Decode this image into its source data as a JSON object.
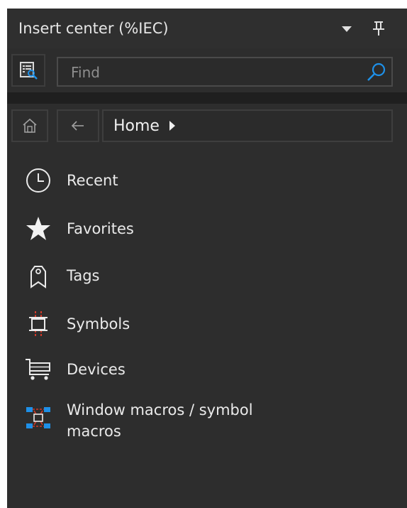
{
  "panel": {
    "title": "Insert center (%IEC)"
  },
  "search": {
    "placeholder": "Find",
    "value": ""
  },
  "breadcrumb": {
    "current": "Home"
  },
  "nav_items": [
    {
      "label": "Recent",
      "icon": "clock-icon"
    },
    {
      "label": "Favorites",
      "icon": "star-icon"
    },
    {
      "label": "Tags",
      "icon": "tag-icon"
    },
    {
      "label": "Symbols",
      "icon": "symbol-icon"
    },
    {
      "label": "Devices",
      "icon": "cart-icon"
    },
    {
      "label": "Window macros / symbol macros",
      "icon": "window-macro-icon"
    }
  ],
  "colors": {
    "panel_bg": "#2d2d2d",
    "text": "#eaeaea",
    "accent_blue": "#1e90e8",
    "symbol_red": "#d23a2a"
  }
}
